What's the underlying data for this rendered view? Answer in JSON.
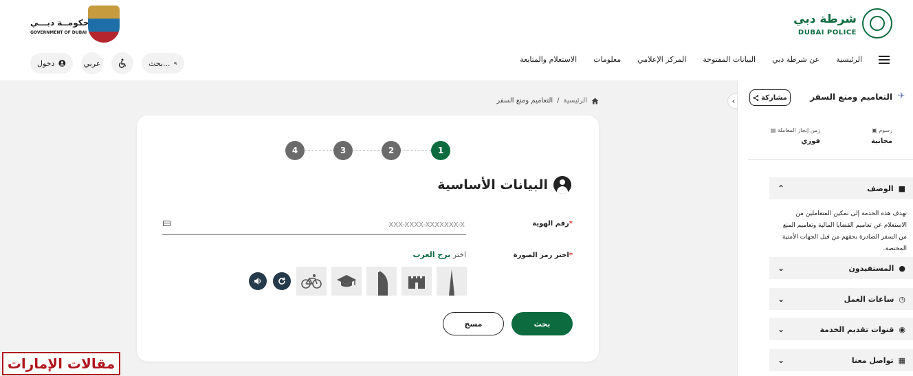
{
  "header": {
    "dubai_police_ar": "شرطة دبي",
    "dubai_police_en": "DUBAI POLICE",
    "gov_ar": "حكومــة دبـــي",
    "gov_en": "GOVERNMENT OF DUBAI",
    "nav": [
      "الرئيسية",
      "عن شرطة دبي",
      "البيانات المفتوحة",
      "المركز الإعلامي",
      "معلومات",
      "الاستعلام والمتابعة"
    ],
    "search_label": "بحث...",
    "language_label": "عربي",
    "login_label": "دخول"
  },
  "breadcrumb": {
    "home": "الرئيسية",
    "separator": "/",
    "current": "التعاميم ومنع السفر"
  },
  "sidebar": {
    "title": "التعاميم ومنع السفر",
    "share_label": "مشاركة",
    "fees_label": "رسوم",
    "fees_value": "مجانية",
    "time_label": "زمن إنجاز المعاملة",
    "time_value": "فوري",
    "description_label": "الوصف",
    "description_text": "تهدف هذه الخدمة إلى تمكين المتعاملين من الاستعلام عن تعاميم القضايا المالية وتعاميم المنع من السفر الصادرة بحقهم من قبل الجهات الأمنية المختصة.",
    "beneficiaries_label": "المستفيدون",
    "working_hours_label": "ساعات العمل",
    "channels_label": "قنوات تقديم الخدمة",
    "contact_label": "تواصل معنا"
  },
  "form": {
    "steps": [
      "1",
      "2",
      "3",
      "4"
    ],
    "active_step": 1,
    "section_title": "البيانات الأساسية",
    "id_label": "رقم الهوية",
    "id_placeholder": "XXX-XXXX-XXXXXXX-X",
    "captcha_label": "اختر رمز الصورة",
    "captcha_hint_prefix": "اختر",
    "captcha_target": "برج العرب",
    "captcha_tiles": [
      "burj-khalifa-icon",
      "fort-icon",
      "burj-al-arab-icon",
      "graduation-cap-icon",
      "bicycle-icon"
    ],
    "search_button": "بحث",
    "clear_button": "مسح"
  },
  "watermark": "مقالات الإمارات",
  "colors": {
    "brand_green": "#0c6b3f",
    "step_inactive": "#6b6b6b",
    "watermark_red": "#b0171f"
  }
}
